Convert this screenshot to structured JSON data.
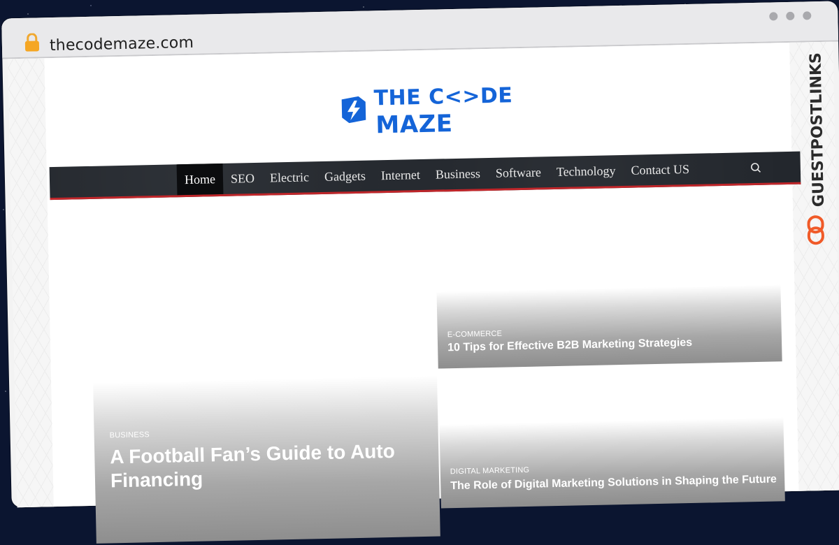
{
  "browser": {
    "url": "thecodemaze.com"
  },
  "side_brand": {
    "text": "GUESTPOSTLINKS",
    "colors": {
      "icon": "#f05a28",
      "text": "#2b2b2b"
    }
  },
  "logo": {
    "line1": "THE C<>DE",
    "line2": "MAZE",
    "color": "#1464d8"
  },
  "nav": {
    "items": [
      "Home",
      "SEO",
      "Electric",
      "Gadgets",
      "Internet",
      "Business",
      "Software",
      "Technology",
      "Contact US"
    ],
    "active": "Home",
    "accent": "#c0262a"
  },
  "posts": {
    "featured": {
      "category": "BUSINESS",
      "title": "A Football Fan’s Guide to Auto Financing"
    },
    "side1": {
      "category": "E-COMMERCE",
      "title": "10 Tips for Effective B2B Marketing Strategies"
    },
    "side2": {
      "category": "DIGITAL MARKETING",
      "title": "The Role of Digital Marketing Solutions in Shaping the Future"
    }
  }
}
